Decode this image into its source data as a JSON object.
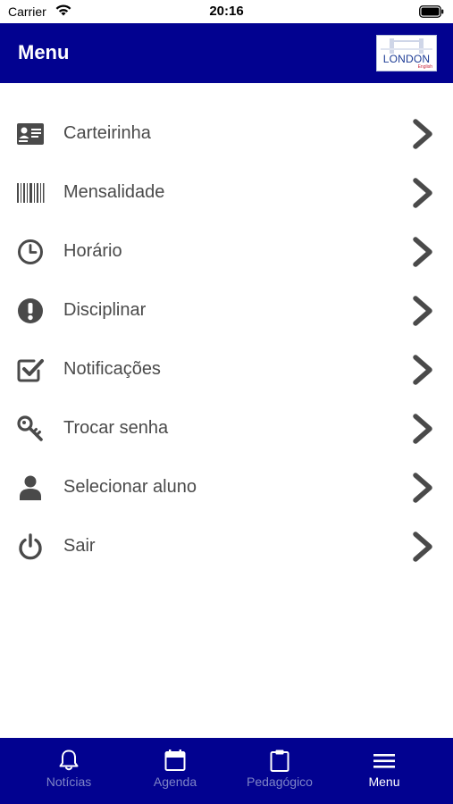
{
  "status_bar": {
    "carrier": "Carrier",
    "time": "20:16"
  },
  "header": {
    "title": "Menu",
    "logo_text": "LONDON",
    "logo_subtext": "English"
  },
  "menu": {
    "items": [
      {
        "label": "Carteirinha",
        "icon": "id-card-icon"
      },
      {
        "label": "Mensalidade",
        "icon": "barcode-icon"
      },
      {
        "label": "Horário",
        "icon": "clock-icon"
      },
      {
        "label": "Disciplinar",
        "icon": "exclamation-icon"
      },
      {
        "label": "Notificações",
        "icon": "check-square-icon"
      },
      {
        "label": "Trocar senha",
        "icon": "key-icon"
      },
      {
        "label": "Selecionar aluno",
        "icon": "user-icon"
      },
      {
        "label": "Sair",
        "icon": "power-icon"
      }
    ]
  },
  "tabs": {
    "items": [
      {
        "label": "Notícias",
        "icon": "bell-icon"
      },
      {
        "label": "Agenda",
        "icon": "calendar-icon"
      },
      {
        "label": "Pedagógico",
        "icon": "clipboard-icon"
      },
      {
        "label": "Menu",
        "icon": "hamburger-menu-icon"
      }
    ],
    "active": "Menu"
  },
  "colors": {
    "primary": "#020290",
    "icon_gray": "#4a4a4a",
    "tab_inactive": "#7e84c6",
    "tab_active": "#ffffff"
  }
}
